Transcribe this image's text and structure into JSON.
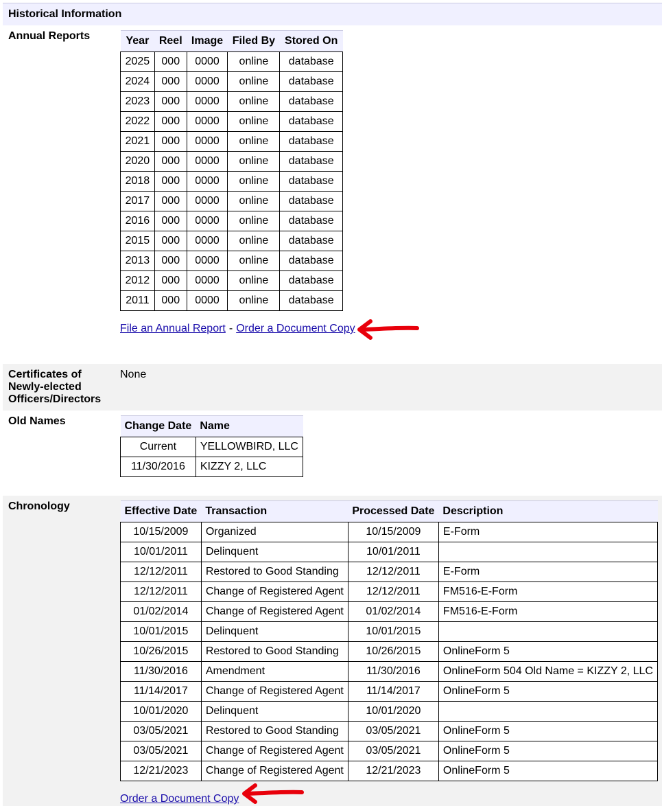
{
  "section_title": "Historical Information",
  "annual_reports": {
    "label": "Annual Reports",
    "headers": [
      "Year",
      "Reel",
      "Image",
      "Filed By",
      "Stored On"
    ],
    "rows": [
      [
        "2025",
        "000",
        "0000",
        "online",
        "database"
      ],
      [
        "2024",
        "000",
        "0000",
        "online",
        "database"
      ],
      [
        "2023",
        "000",
        "0000",
        "online",
        "database"
      ],
      [
        "2022",
        "000",
        "0000",
        "online",
        "database"
      ],
      [
        "2021",
        "000",
        "0000",
        "online",
        "database"
      ],
      [
        "2020",
        "000",
        "0000",
        "online",
        "database"
      ],
      [
        "2018",
        "000",
        "0000",
        "online",
        "database"
      ],
      [
        "2017",
        "000",
        "0000",
        "online",
        "database"
      ],
      [
        "2016",
        "000",
        "0000",
        "online",
        "database"
      ],
      [
        "2015",
        "000",
        "0000",
        "online",
        "database"
      ],
      [
        "2013",
        "000",
        "0000",
        "online",
        "database"
      ],
      [
        "2012",
        "000",
        "0000",
        "online",
        "database"
      ],
      [
        "2011",
        "000",
        "0000",
        "online",
        "database"
      ]
    ],
    "file_link": "File an Annual Report",
    "separator": "-",
    "order_link": "Order a Document Copy"
  },
  "certificates": {
    "label_lines": [
      "Certificates of",
      "Newly-elected",
      "Officers/Directors"
    ],
    "value": "None"
  },
  "old_names": {
    "label": "Old Names",
    "headers": [
      "Change Date",
      "Name"
    ],
    "rows": [
      [
        "Current",
        "YELLOWBIRD, LLC"
      ],
      [
        "11/30/2016",
        "KIZZY 2, LLC"
      ]
    ]
  },
  "chronology": {
    "label": "Chronology",
    "headers": [
      "Effective Date",
      "Transaction",
      "Processed Date",
      "Description"
    ],
    "rows": [
      [
        "10/15/2009",
        "Organized",
        "10/15/2009",
        "E-Form"
      ],
      [
        "10/01/2011",
        "Delinquent",
        "10/01/2011",
        ""
      ],
      [
        "12/12/2011",
        "Restored to Good Standing",
        "12/12/2011",
        "E-Form"
      ],
      [
        "12/12/2011",
        "Change of Registered Agent",
        "12/12/2011",
        "FM516-E-Form"
      ],
      [
        "01/02/2014",
        "Change of Registered Agent",
        "01/02/2014",
        "FM516-E-Form"
      ],
      [
        "10/01/2015",
        "Delinquent",
        "10/01/2015",
        ""
      ],
      [
        "10/26/2015",
        "Restored to Good Standing",
        "10/26/2015",
        "OnlineForm 5"
      ],
      [
        "11/30/2016",
        "Amendment",
        "11/30/2016",
        "OnlineForm 504 Old Name = KIZZY 2, LLC"
      ],
      [
        "11/14/2017",
        "Change of Registered Agent",
        "11/14/2017",
        "OnlineForm 5"
      ],
      [
        "10/01/2020",
        "Delinquent",
        "10/01/2020",
        ""
      ],
      [
        "03/05/2021",
        "Restored to Good Standing",
        "03/05/2021",
        "OnlineForm 5"
      ],
      [
        "03/05/2021",
        "Change of Registered Agent",
        "03/05/2021",
        "OnlineForm 5"
      ],
      [
        "12/21/2023",
        "Change of Registered Agent",
        "12/21/2023",
        "OnlineForm 5"
      ]
    ],
    "order_link": "Order a Document Copy"
  },
  "colors": {
    "header_bg": "#f0f0ff",
    "band_bg": "#f2f2f2",
    "link": "#1a0dab",
    "annotation_arrow": "#e8000b"
  },
  "annotation_icons": [
    "red-arrow-icon"
  ]
}
